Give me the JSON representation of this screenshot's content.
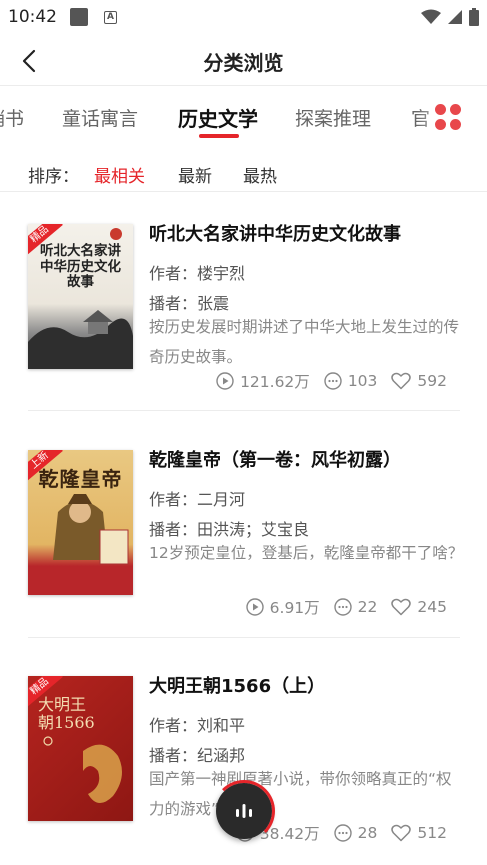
{
  "status_bar": {
    "time": "10:42"
  },
  "header": {
    "title": "分类浏览"
  },
  "tabs": [
    {
      "label": "销书"
    },
    {
      "label": "童话寓言"
    },
    {
      "label": "历史文学",
      "active": true
    },
    {
      "label": "探案推理"
    },
    {
      "label": "官"
    }
  ],
  "sort": {
    "label": "排序：",
    "options": [
      {
        "label": "最相关",
        "active": true
      },
      {
        "label": "最新"
      },
      {
        "label": "最热"
      }
    ]
  },
  "books": [
    {
      "title": "听北大名家讲中华历史文化故事",
      "author": "作者：楼宇烈",
      "narrator": "播者：张震",
      "description": "按历史发展时期讲述了中华大地上发生过的传奇历史故事。",
      "plays": "121.62万",
      "comments": "103",
      "likes": "592",
      "badge": "精品",
      "cover_title": "听北大名家讲中华历史文化故事"
    },
    {
      "title": "乾隆皇帝（第一卷：风华初露）",
      "author": "作者：二月河",
      "narrator": "播者：田洪涛；艾宝良",
      "description": "12岁预定皇位，登基后，乾隆皇帝都干了啥？",
      "plays": "6.91万",
      "comments": "22",
      "likes": "245",
      "badge": "上新",
      "cover_title": "乾隆皇帝"
    },
    {
      "title": "大明王朝1566（上）",
      "author": "作者：刘和平",
      "narrator": "播者：纪涵邦",
      "description": "国产第一神剧原著小说，带你领略真正的“权力的游戏”",
      "plays": "38.42万",
      "comments": "28",
      "likes": "512",
      "badge": "精品",
      "cover_title": "大明王朝1566"
    }
  ],
  "colors": {
    "accent": "#e5252a",
    "text": "#222222",
    "muted": "#888888"
  }
}
